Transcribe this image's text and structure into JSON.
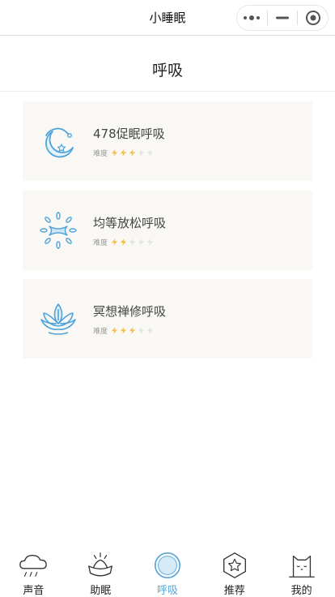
{
  "navbar": {
    "title": "小睡眠"
  },
  "page": {
    "title": "呼吸"
  },
  "difficulty_label": "难度",
  "cards": [
    {
      "title": "478促眠呼吸",
      "difficulty": 3,
      "max_difficulty": 5,
      "icon": "moon-icon"
    },
    {
      "title": "均等放松呼吸",
      "difficulty": 2,
      "max_difficulty": 5,
      "icon": "sun-leaves-icon"
    },
    {
      "title": "冥想禅修呼吸",
      "difficulty": 3,
      "max_difficulty": 5,
      "icon": "lotus-icon"
    }
  ],
  "tabs": [
    {
      "label": "声音",
      "icon": "cloud-rain-icon",
      "active": false
    },
    {
      "label": "助眠",
      "icon": "lotus-sparkle-icon",
      "active": false
    },
    {
      "label": "呼吸",
      "icon": "breath-circle-icon",
      "active": true
    },
    {
      "label": "推荐",
      "icon": "star-hexagon-icon",
      "active": false
    },
    {
      "label": "我的",
      "icon": "cat-icon",
      "active": false
    }
  ],
  "colors": {
    "accent": "#5aa6d8",
    "bolt_on": "#f5c04a",
    "bolt_off": "#e2e2e2",
    "card_bg": "#f9f8f4"
  }
}
